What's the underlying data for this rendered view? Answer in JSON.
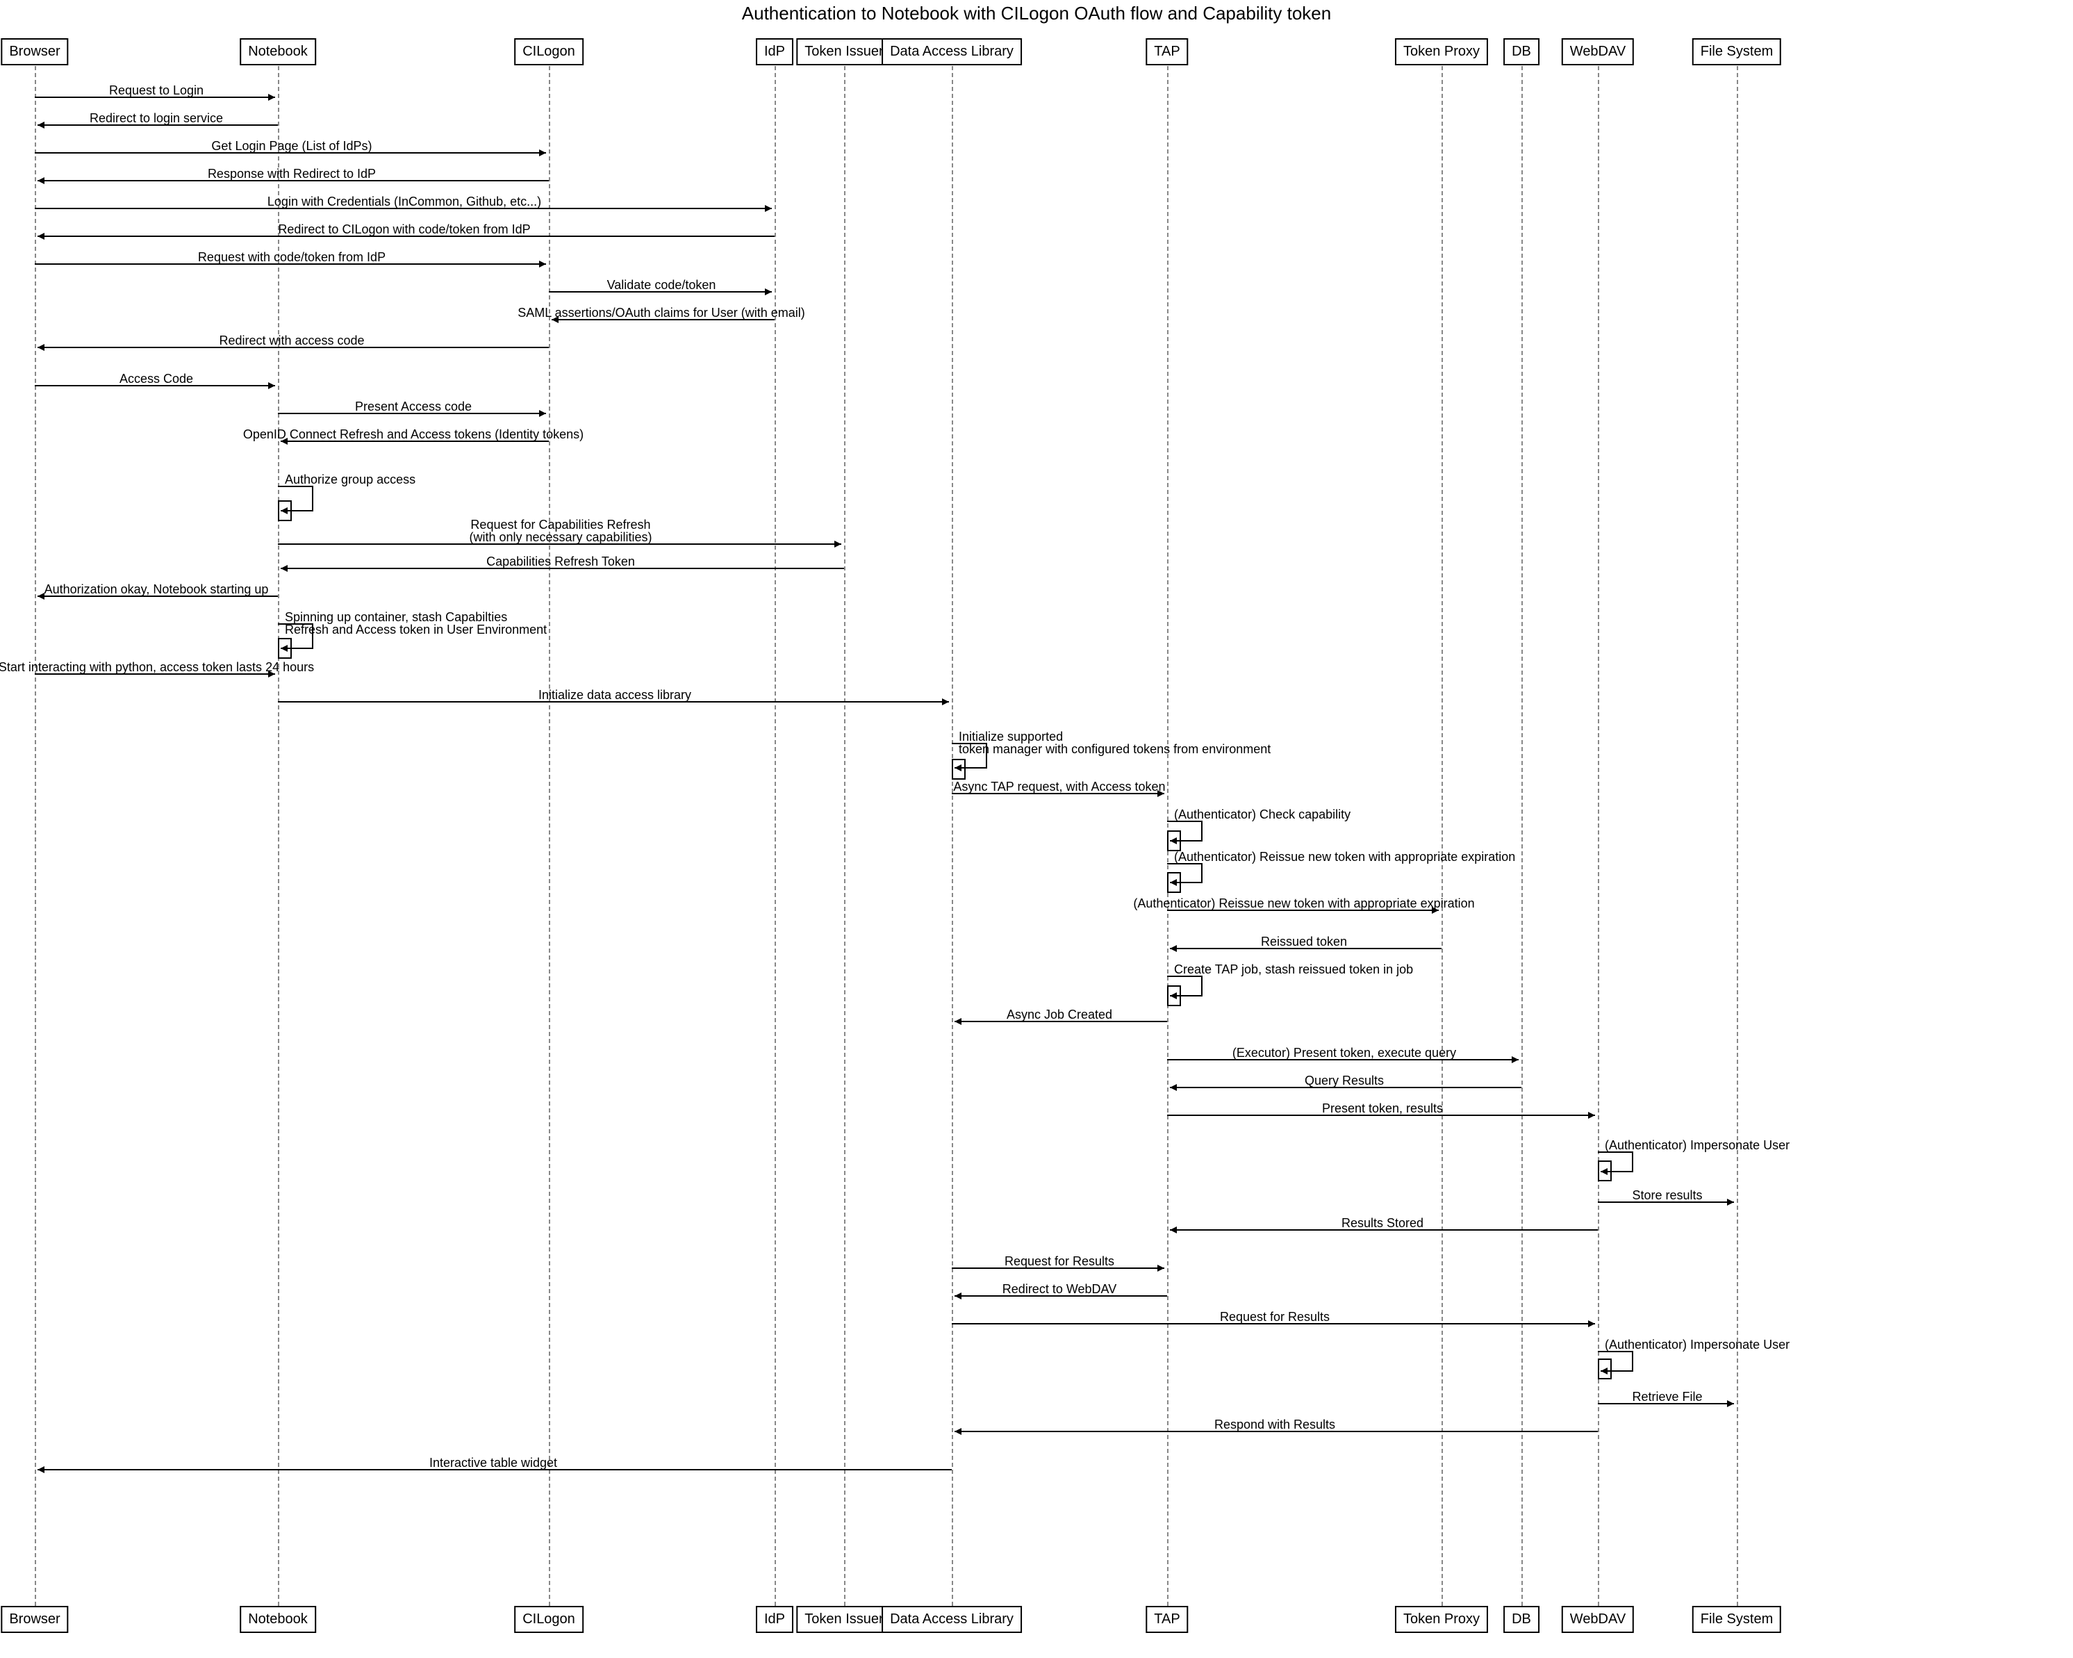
{
  "title": "Authentication to Notebook with CILogon OAuth flow and Capability token",
  "participants": {
    "browser": "Browser",
    "notebook": "Notebook",
    "cilogon": "CILogon",
    "idp": "IdP",
    "token_issuer": "Token Issuer",
    "dal": "Data Access Library",
    "tap": "TAP",
    "token_proxy": "Token Proxy",
    "db": "DB",
    "webdav": "WebDAV",
    "fs": "File System"
  },
  "messages": {
    "m1": "Request to Login",
    "m2": "Redirect to login service",
    "m3": "Get Login Page (List of IdPs)",
    "m4": "Response with Redirect to IdP",
    "m5": "Login with Credentials (InCommon, Github, etc...)",
    "m6": "Redirect to CILogon with code/token from IdP",
    "m7": "Request with code/token from IdP",
    "m8": "Validate code/token",
    "m9": "SAML assertions/OAuth claims for User (with email)",
    "m10": "Redirect with access code",
    "m11": "Access Code",
    "m12": "Present Access code",
    "m13": "OpenID Connect Refresh and Access tokens (Identity tokens)",
    "m14": "Authorize group access",
    "m15a": "Request for Capabilities Refresh",
    "m15b": "(with only necessary capabilities)",
    "m16": "Capabilities Refresh Token",
    "m17": "Authorization okay, Notebook starting up",
    "m18a": "Spinning up container, stash Capabilties",
    "m18b": "Refresh and Access token in User Environment",
    "m19": "Start interacting with python, access token lasts 24 hours",
    "m20": "Initialize data access library",
    "m21a": "Initialize supported",
    "m21b": "token manager with configured tokens from environment",
    "m22": "Async TAP request, with Access token",
    "m23": "(Authenticator) Check capability",
    "m24": "(Authenticator) Reissue new token with appropriate expiration",
    "m25": "(Authenticator) Reissue new token with appropriate expiration",
    "m26": "Reissued token",
    "m27": "Create TAP job, stash reissued token in job",
    "m28": "Async Job Created",
    "m29": "(Executor) Present token, execute query",
    "m30": "Query Results",
    "m31": "Present token, results",
    "m32": "(Authenticator) Impersonate User",
    "m33": "Store results",
    "m34": "Results Stored",
    "m35": "Request for Results",
    "m36": "Redirect to WebDAV",
    "m37": "Request for Results",
    "m38": "(Authenticator) Impersonate User",
    "m39": "Retrieve File",
    "m40": "Respond with Results",
    "m41": "Interactive table widget"
  }
}
